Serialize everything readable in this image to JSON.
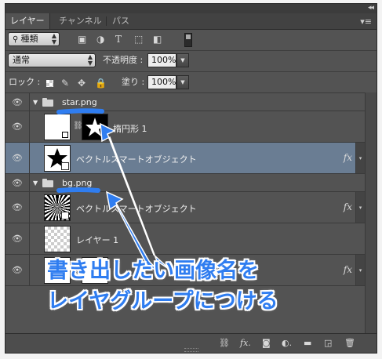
{
  "tabs": [
    "レイヤー",
    "チャンネル",
    "パス"
  ],
  "filter": {
    "kind_label": "種類"
  },
  "blend": {
    "mode": "通常",
    "opacity_label": "不透明度 :",
    "opacity_value": "100%"
  },
  "lock": {
    "label": "ロック :",
    "fill_label": "塗り :",
    "fill_value": "100%"
  },
  "layers": [
    {
      "name": "star.png"
    },
    {
      "name": "楕円形 1"
    },
    {
      "name": "ベクトルスマートオブジェクト"
    },
    {
      "name": "bg.png"
    },
    {
      "name": "ベクトルスマートオブジェクト"
    },
    {
      "name": "レイヤー 1"
    }
  ],
  "fx_label": "fx",
  "annotation": {
    "line1": "書き出したい画像名を",
    "line2": "レイヤグループにつける",
    "color": "#2f7df0"
  },
  "icons": [
    "search-icon",
    "image-filter-icon",
    "adjustment-filter-icon",
    "type-filter-icon",
    "shape-filter-icon",
    "smart-object-filter-icon",
    "eye-icon",
    "folder-icon",
    "link-icon",
    "fx-icon",
    "mask-icon",
    "new-fill-icon",
    "new-group-icon",
    "new-layer-icon",
    "trash-icon"
  ]
}
